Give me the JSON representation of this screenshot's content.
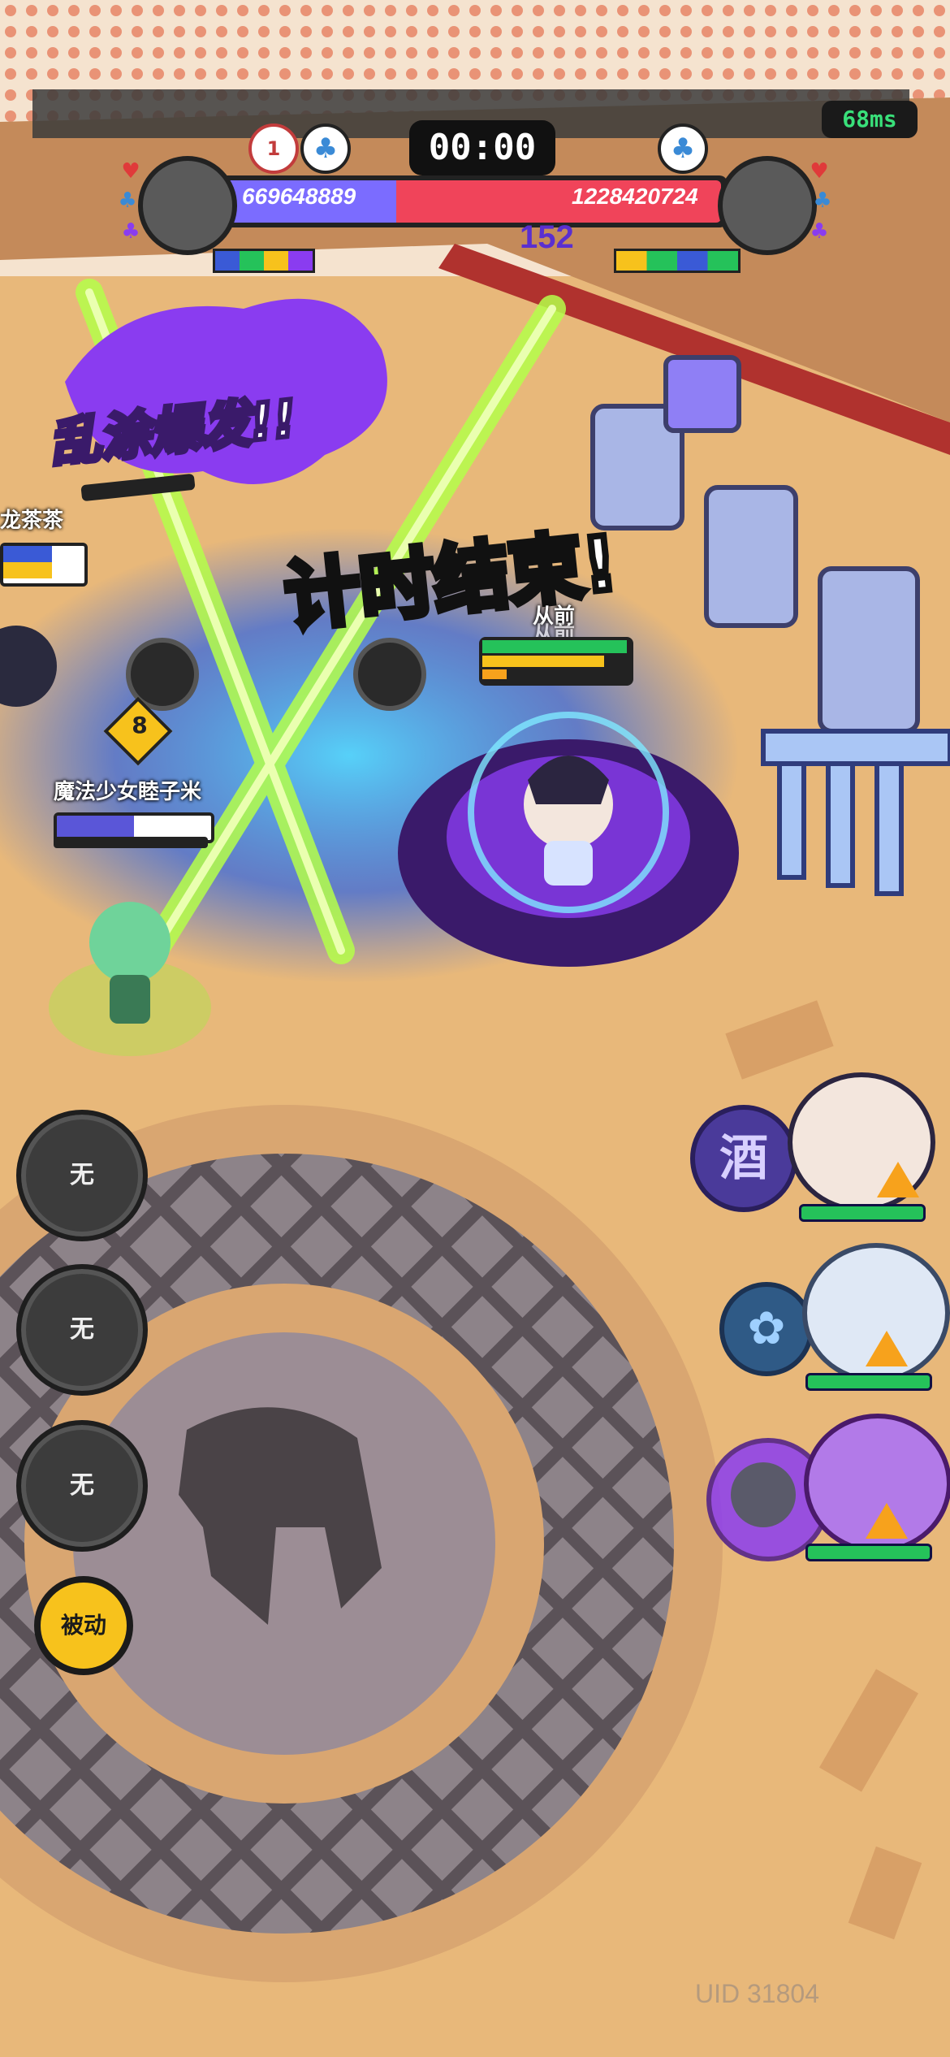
{
  "hud": {
    "ping": "68ms",
    "timer": "00:00",
    "left_team_score": "669648889",
    "right_team_score": "1228420724",
    "left_kills": "1",
    "partial_score_behind": "152"
  },
  "banners": {
    "ability_text": "乱涂爆发!!",
    "time_up_text": "计时结束!"
  },
  "players": {
    "offscreen_name": "龙茶茶",
    "ally_name": "魔法少女睦子米",
    "ally_level": "8",
    "enemy_name_line1": "从前",
    "enemy_name_line2": "从前"
  },
  "skills": {
    "skill1_label": "无",
    "skill2_label": "无",
    "skill3_label": "无",
    "passive_label": "被动"
  },
  "team_panel": {
    "slot1_badge_glyph": "酒"
  },
  "footer": {
    "uid": "UID 31804"
  },
  "colors": {
    "team_blue": "#7b6cff",
    "team_red": "#f0445a",
    "accent_purple": "#8a3cf0",
    "accent_green": "#9cf03c",
    "floor": "#e8b87a"
  }
}
